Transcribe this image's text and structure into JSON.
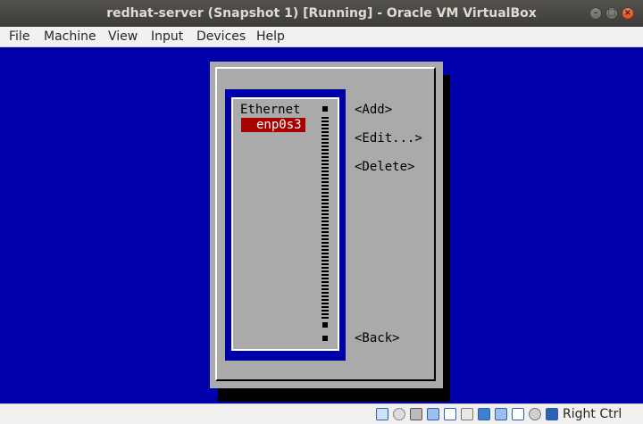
{
  "window": {
    "title": "redhat-server (Snapshot 1) [Running] - Oracle VM VirtualBox"
  },
  "menu": {
    "items": [
      {
        "label": "File"
      },
      {
        "label": "Machine"
      },
      {
        "label": "View"
      },
      {
        "label": "Input"
      },
      {
        "label": "Devices"
      },
      {
        "label": "Help"
      }
    ]
  },
  "nmtui": {
    "list_header": "Ethernet",
    "connections": [
      {
        "label": "enp0s3",
        "selected": true
      }
    ],
    "buttons": {
      "add": "<Add>",
      "edit": "<Edit...>",
      "delete": "<Delete>",
      "back": "<Back>"
    },
    "colors": {
      "screen_bg": "#0000aa",
      "dialog_bg": "#aaaaaa",
      "selection_bg": "#aa0000"
    }
  },
  "statusbar": {
    "icons": [
      "hard-disk-icon",
      "optical-drive-icon",
      "audio-icon",
      "network-icon",
      "usb-icon",
      "shared-folders-icon",
      "display-icon",
      "video-capture-icon",
      "recording-icon",
      "cpu-icon",
      "mouse-integration-icon",
      "keyboard-icon"
    ],
    "host_key": "Right Ctrl"
  }
}
